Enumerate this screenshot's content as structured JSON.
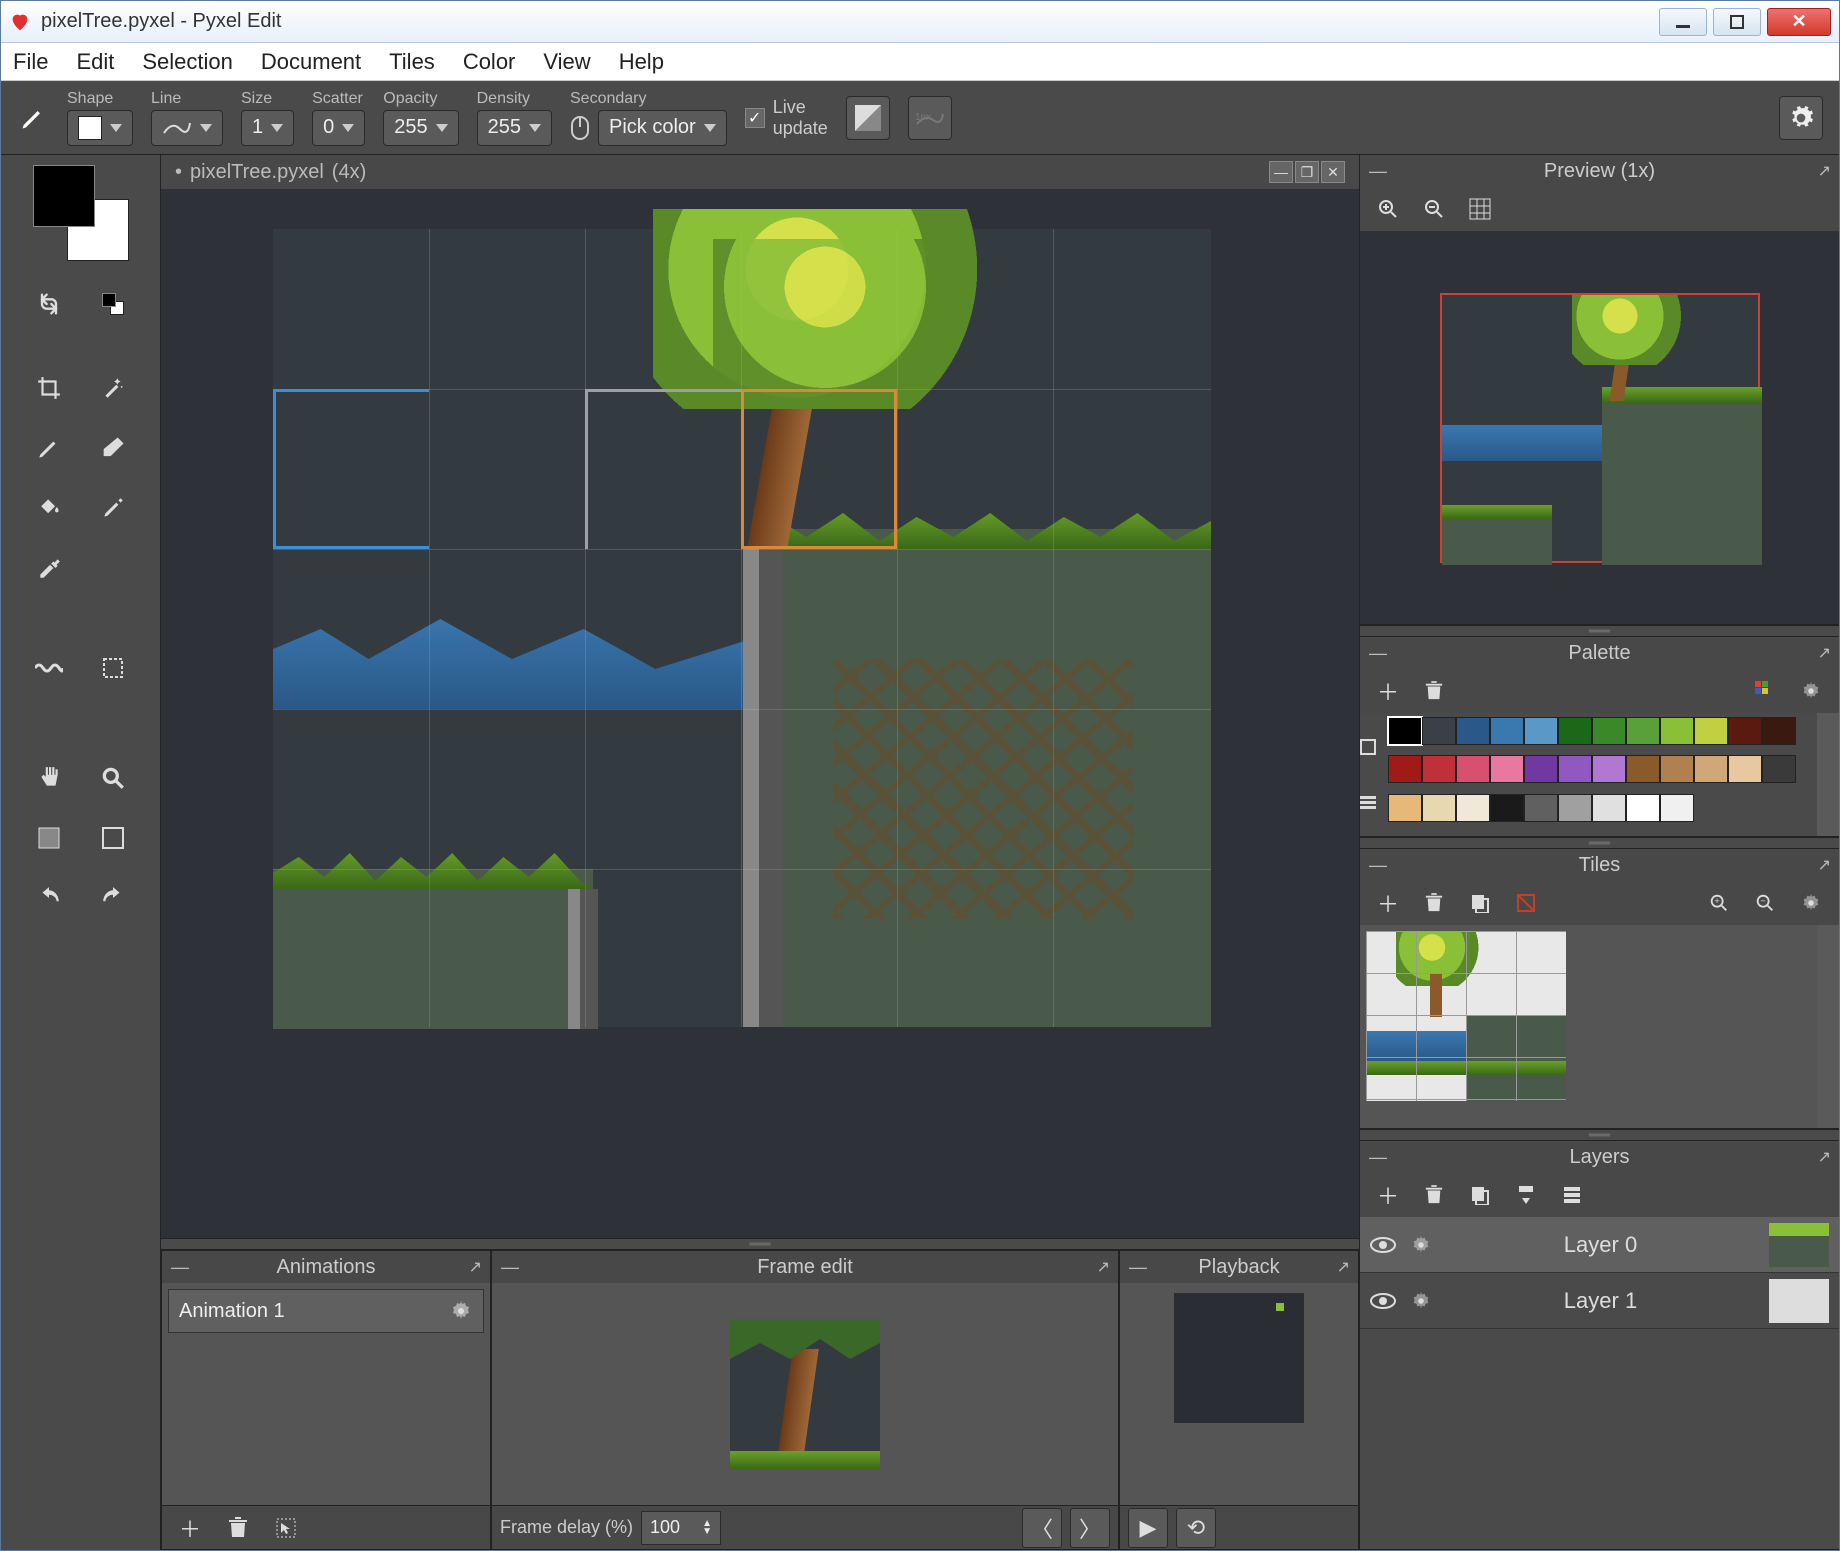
{
  "window": {
    "title": "pixelTree.pyxel - Pyxel Edit"
  },
  "menu": [
    "File",
    "Edit",
    "Selection",
    "Document",
    "Tiles",
    "Color",
    "View",
    "Help"
  ],
  "toolbar": {
    "shape_label": "Shape",
    "line_label": "Line",
    "size_label": "Size",
    "size_value": "1",
    "scatter_label": "Scatter",
    "scatter_value": "0",
    "opacity_label": "Opacity",
    "opacity_value": "255",
    "density_label": "Density",
    "density_value": "255",
    "secondary_label": "Secondary",
    "secondary_value": "Pick color",
    "live_update": "Live\nupdate",
    "live_update_checked": true
  },
  "document": {
    "tab_name": "pixelTree.pyxel",
    "zoom": "(4x)",
    "modified": true
  },
  "panels": {
    "preview": {
      "title": "Preview (1x)"
    },
    "palette": {
      "title": "Palette",
      "colors": [
        "#000000",
        "#3a4048",
        "#2a5888",
        "#3a78b0",
        "#5a98c8",
        "#1a6818",
        "#3a8828",
        "#5aa038",
        "#8ac038",
        "#c0d040",
        "#5a1a10",
        "#3a1a10",
        "#a01a18",
        "#c03038",
        "#d85070",
        "#e878a0",
        "#7038a0",
        "#9058c0",
        "#b078d0",
        "#8a5a2a",
        "#b08050",
        "#d0a878",
        "#e8c8a0",
        "#3a3a3a",
        "#e8b878",
        "#e8d8b0",
        "#f0e8d8",
        "#1a1a1a",
        "#606060",
        "#a0a0a0",
        "#e0e0e0",
        "#ffffff",
        "#f0f0f0"
      ],
      "selected_index": 0
    },
    "tiles": {
      "title": "Tiles"
    },
    "layers": {
      "title": "Layers",
      "items": [
        {
          "name": "Layer 0",
          "visible": true,
          "active": true
        },
        {
          "name": "Layer 1",
          "visible": true,
          "active": false
        }
      ]
    },
    "animations": {
      "title": "Animations",
      "items": [
        "Animation 1"
      ]
    },
    "frame_edit": {
      "title": "Frame edit",
      "delay_label": "Frame delay (%)",
      "delay_value": "100"
    },
    "playback": {
      "title": "Playback"
    }
  }
}
